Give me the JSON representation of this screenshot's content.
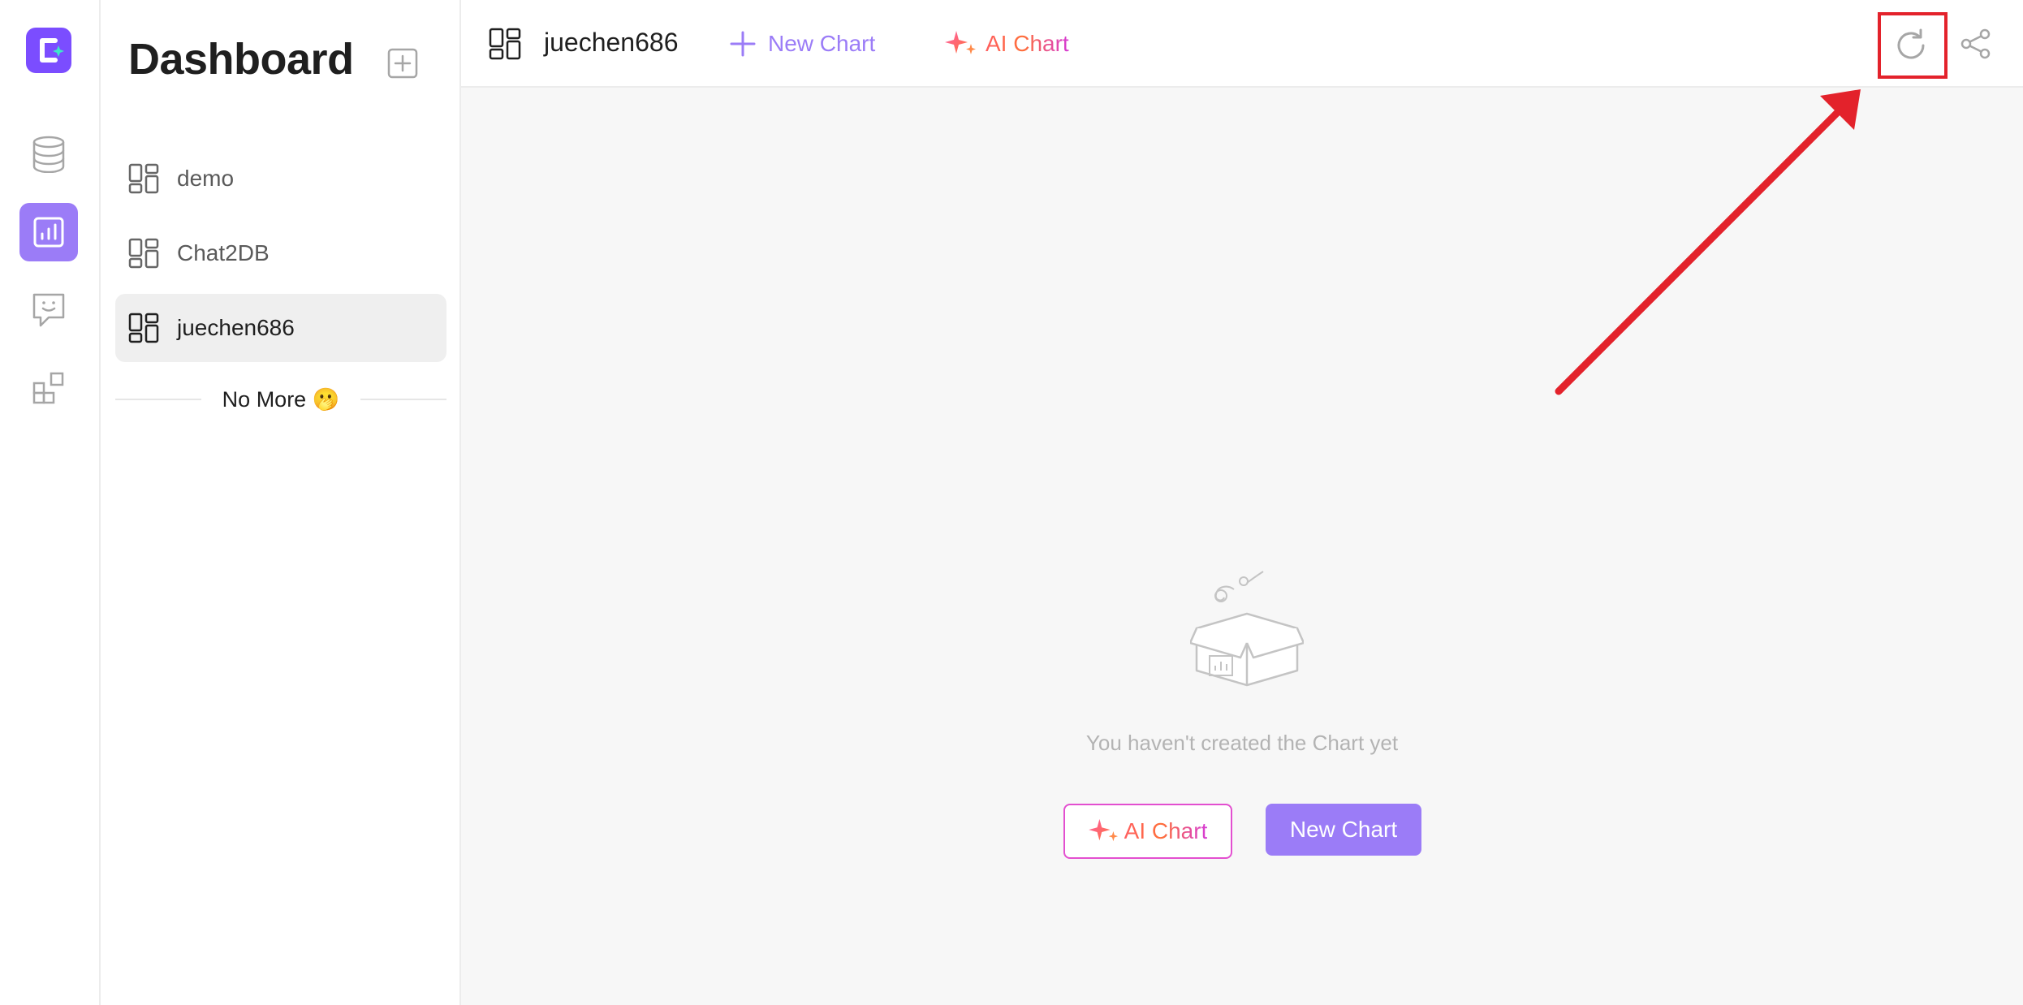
{
  "colors": {
    "accent": "#9b7cf7",
    "brand": "#7b4dff",
    "annotation": "#e3222b",
    "ai_gradient": [
      "#ff5f5f",
      "#d63bd6"
    ]
  },
  "rail": {
    "items": [
      {
        "icon": "database-icon"
      },
      {
        "icon": "dashboard-chart-icon",
        "active": true
      },
      {
        "icon": "chat-bot-icon"
      },
      {
        "icon": "apps-icon"
      }
    ]
  },
  "sidebar": {
    "title": "Dashboard",
    "items": [
      {
        "label": "demo"
      },
      {
        "label": "Chat2DB"
      },
      {
        "label": "juechen686",
        "selected": true
      }
    ],
    "end_text": "No More 🫢"
  },
  "header": {
    "board_name": "juechen686",
    "new_chart_label": "New Chart",
    "ai_chart_label": "AI Chart"
  },
  "empty_state": {
    "message": "You haven't created the Chart yet",
    "ai_chart_button": "AI Chart",
    "new_chart_button": "New Chart"
  }
}
